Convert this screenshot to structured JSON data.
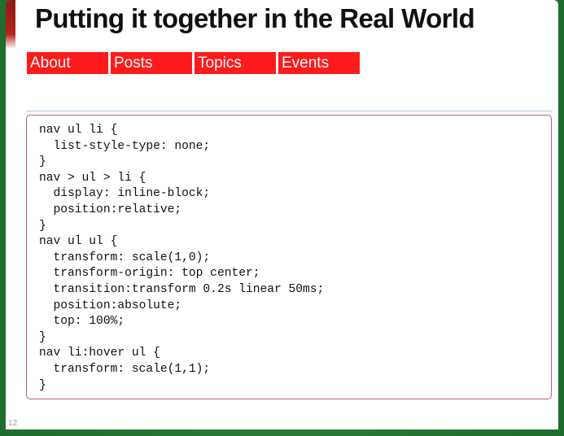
{
  "slide": {
    "title": "Putting it together in the Real World",
    "page_number": "12"
  },
  "nav": {
    "items": [
      {
        "label": "About"
      },
      {
        "label": "Posts"
      },
      {
        "label": "Topics"
      },
      {
        "label": "Events"
      }
    ],
    "background_color": "#ff1b1b",
    "text_color": "#ffffff"
  },
  "code": {
    "lines": [
      "nav ul li {",
      "  list-style-type: none;",
      "}",
      "nav > ul > li {",
      "  display: inline-block;",
      "  position:relative;",
      "}",
      "nav ul ul {",
      "  transform: scale(1,0);",
      "  transform-origin: top center;",
      "  transition:transform 0.2s linear 50ms;",
      "  position:absolute;",
      "  top: 100%;",
      "}",
      "nav li:hover ul {",
      "  transform: scale(1,1);",
      "}"
    ],
    "border_color": "#c06070"
  },
  "theme": {
    "frame_color": "#1f6e2b",
    "accent_red": "#b8231b"
  }
}
